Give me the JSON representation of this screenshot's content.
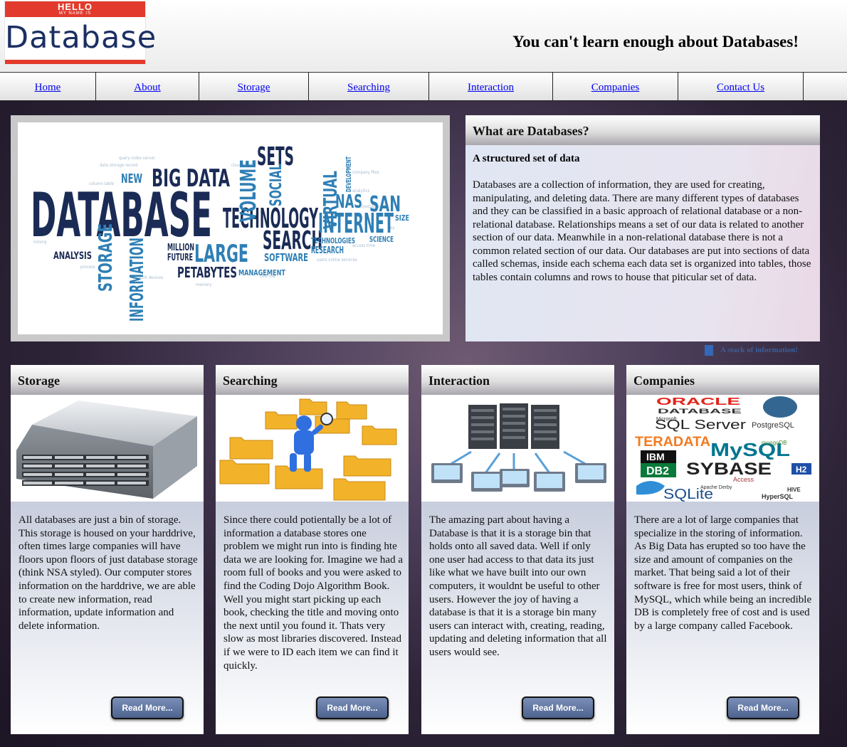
{
  "logo": {
    "hello": "HELLO",
    "my_name_is": "MY NAME IS",
    "word": "Database"
  },
  "header": {
    "tagline": "You can't learn enough about Databases!"
  },
  "nav": {
    "items": [
      {
        "label": "Home"
      },
      {
        "label": "About"
      },
      {
        "label": "Storage"
      },
      {
        "label": "Searching"
      },
      {
        "label": "Interaction"
      },
      {
        "label": "Companies"
      },
      {
        "label": "Contact Us"
      }
    ]
  },
  "hero": {
    "words": {
      "database": "DATABASE",
      "big_data": "BIG DATA",
      "technology": "TECHNOLOGY",
      "search": "SEARCH",
      "internet": "INTERNET",
      "sets": "SETS",
      "volume": "VOLUME",
      "social": "SOCIAL",
      "virtual": "VIRTUAL",
      "nas": "NAS",
      "san": "SAN",
      "large": "LARGE",
      "petabytes": "PETABYTES",
      "storage": "STORAGE",
      "information": "INFORMATION",
      "software": "SOFTWARE",
      "management": "MANAGEMENT",
      "new": "NEW",
      "analysis": "ANALYSIS",
      "future": "FUTURE",
      "million": "MILLION",
      "research": "RESEARCH",
      "technologies": "TECHNOLOGIES",
      "science": "SCIENCE",
      "size": "SIZE",
      "development": "DEVELOPMENT"
    }
  },
  "what": {
    "title": "What are Databases?",
    "subtitle": "A structured set of data",
    "body": "Databases are a collection of information, they are used for creating, manipulating, and deleting data. There are many different types of databases and they can be classified in a basic approach of relational database or a non-relational database. Relationships means a set of our data is related to another section of our data. Meanwhile in a non-relational database there is not a common related section of our data. Our databases are put into sections of data called schemas, inside each schema each data set is organized into tables, those tables contain columns and rows to house that piticular set of data."
  },
  "stack_link": "A stack of information!",
  "cards": [
    {
      "title": "Storage",
      "body": "All databases are just a bin of storage. This storage is housed on your harddrive, often times large companies will have floors upon floors of just database storage (think NSA styled). Our computer stores information on the harddrive, we are able to create new information, read information, update information and delete information.",
      "button": "Read More..."
    },
    {
      "title": "Searching",
      "body": "Since there could potientally be a lot of information a database stores one problem we might run into is finding hte data we are looking for. Imagine we had a room full of books and you were asked to find the Coding Dojo Algorithm Book. Well you might start picking up each book, checking the title and moving onto the next until you found it. Thats very slow as most libraries discovered. Instead if we were to ID each item we can find it quickly.",
      "button": "Read More..."
    },
    {
      "title": "Interaction",
      "body": "The amazing part about having a Database is that it is a storage bin that holds onto all saved data. Well if only one user had access to that data its just like what we have built into our own computers, it wouldnt be useful to other users. However the joy of having a database is that it is a storage bin many users can interact with, creating, reading, updating and deleting information that all users would see.",
      "button": "Read More..."
    },
    {
      "title": "Companies",
      "body": "There are a lot of large companies that specialize in the storing of information. As Big Data has erupted so too have the size and amount of companies on the market. That being said a lot of their software is free for most users, think of MySQL, which while being an incredible DB is completely free of cost and is used by a large company called Facebook.",
      "button": "Read More...",
      "logos": {
        "oracle": "ORACLE",
        "oracle_sub": "DATABASE",
        "sqlserver": "SQL Server",
        "microsoft": "Microsoft",
        "postgres": "PostgreSQL",
        "teradata": "TERADATA",
        "ibm": "IBM",
        "db2": "DB2",
        "mysql": "MySQL",
        "sybase": "SYBASE",
        "h2": "H2",
        "access": "Access",
        "mongodb": "mongoDB",
        "derby": "Apache Derby",
        "sqlite": "SQLite",
        "hypersql": "HyperSQL",
        "hive": "HIVE"
      }
    }
  ]
}
